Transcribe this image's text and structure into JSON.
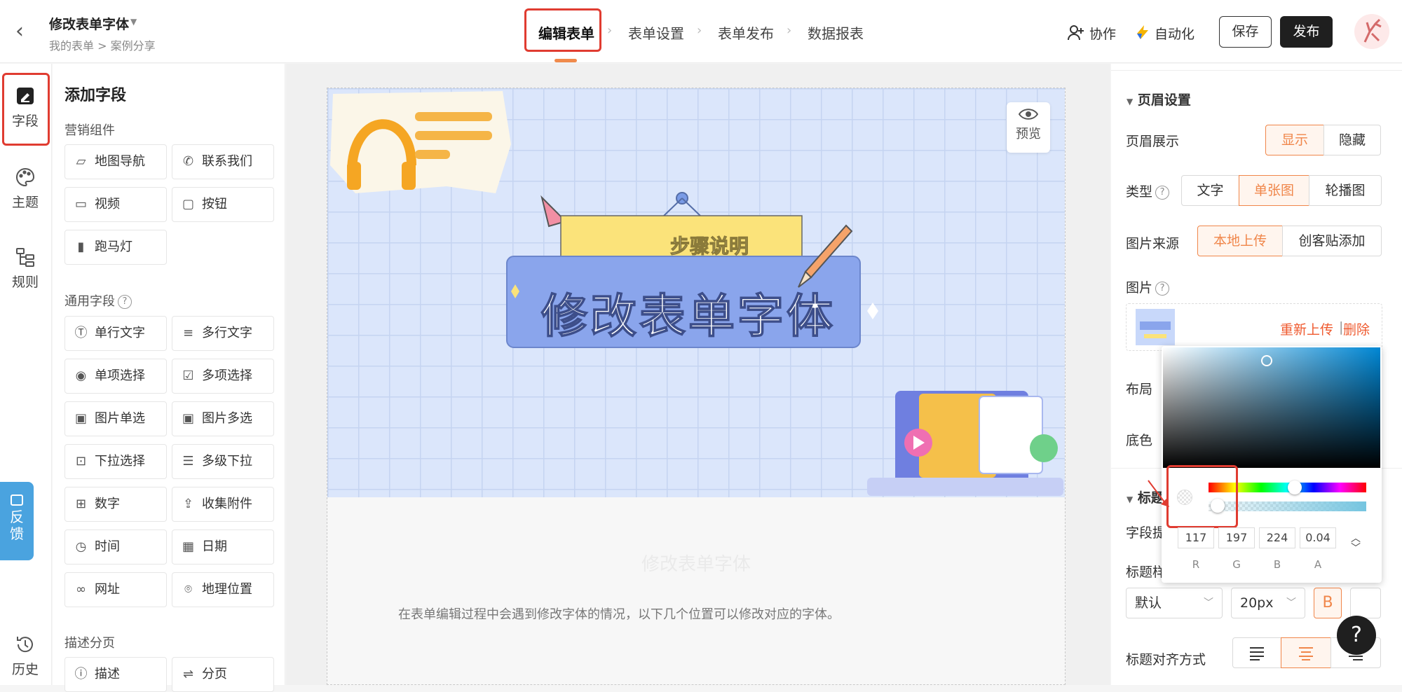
{
  "header": {
    "form_title": "修改表单字体",
    "breadcrumb": "我的表单  >  案例分享",
    "steps": [
      "编辑表单",
      "表单设置",
      "表单发布",
      "数据报表"
    ],
    "collab_label": "协作",
    "automation_label": "自动化",
    "save_label": "保存",
    "publish_label": "发布"
  },
  "rail": {
    "items": [
      "字段",
      "主题",
      "规则",
      "历史"
    ],
    "feedback_label": "反馈"
  },
  "panel": {
    "title": "添加字段",
    "sections": [
      {
        "title": "营销组件",
        "items": [
          {
            "label": "地图导航",
            "icon": "map-icon"
          },
          {
            "label": "联系我们",
            "icon": "phone-icon"
          },
          {
            "label": "视频",
            "icon": "video-icon"
          },
          {
            "label": "按钮",
            "icon": "button-icon"
          },
          {
            "label": "跑马灯",
            "icon": "marquee-icon"
          }
        ]
      },
      {
        "title": "通用字段",
        "items": [
          {
            "label": "单行文字",
            "icon": "text-icon"
          },
          {
            "label": "多行文字",
            "icon": "multiline-icon"
          },
          {
            "label": "单项选择",
            "icon": "radio-icon"
          },
          {
            "label": "多项选择",
            "icon": "checkbox-icon"
          },
          {
            "label": "图片单选",
            "icon": "image-icon"
          },
          {
            "label": "图片多选",
            "icon": "images-icon"
          },
          {
            "label": "下拉选择",
            "icon": "dropdown-icon"
          },
          {
            "label": "多级下拉",
            "icon": "cascade-icon"
          },
          {
            "label": "数字",
            "icon": "number-icon"
          },
          {
            "label": "收集附件",
            "icon": "upload-icon"
          },
          {
            "label": "时间",
            "icon": "clock-icon"
          },
          {
            "label": "日期",
            "icon": "calendar-icon"
          },
          {
            "label": "网址",
            "icon": "link-icon"
          },
          {
            "label": "地理位置",
            "icon": "location-icon"
          }
        ]
      },
      {
        "title": "描述分页",
        "items": [
          {
            "label": "描述",
            "icon": "info-icon"
          },
          {
            "label": "分页",
            "icon": "pagebreak-icon"
          }
        ]
      }
    ]
  },
  "canvas": {
    "preview_label": "预览",
    "banner_subtitle": "步骤说明",
    "banner_title": "修改表单字体",
    "form_title": "修改表单字体",
    "form_description": "在表单编辑过程中会遇到修改字体的情况，以下几个位置可以修改对应的字体。"
  },
  "settings": {
    "header_section": "页眉设置",
    "display_label": "页眉展示",
    "display_options": [
      "显示",
      "隐藏"
    ],
    "display_selected": "显示",
    "type_label": "类型",
    "type_options": [
      "文字",
      "单张图",
      "轮播图"
    ],
    "type_selected": "单张图",
    "source_label": "图片来源",
    "source_options": [
      "本地上传",
      "创客贴添加"
    ],
    "source_selected": "本地上传",
    "image_label": "图片",
    "reupload_label": "重新上传",
    "delete_label": "删除",
    "layout_label": "布局",
    "bg_label": "底色",
    "title_section": "标题",
    "field_label_partial": "字段提",
    "title_style_partial": "标题样",
    "font_select": "默认",
    "size_select": "20px",
    "bold_label": "B",
    "align_label": "标题对齐方式"
  },
  "color_picker": {
    "r": "117",
    "g": "197",
    "b": "224",
    "a": "0.04",
    "labels": [
      "R",
      "G",
      "B",
      "A"
    ],
    "color_hex": "#75c5e0"
  },
  "help_label": "?",
  "colors": {
    "accent": "#f0864a",
    "highlight_red": "#e03c31",
    "feedback_blue": "#4aa3df"
  }
}
